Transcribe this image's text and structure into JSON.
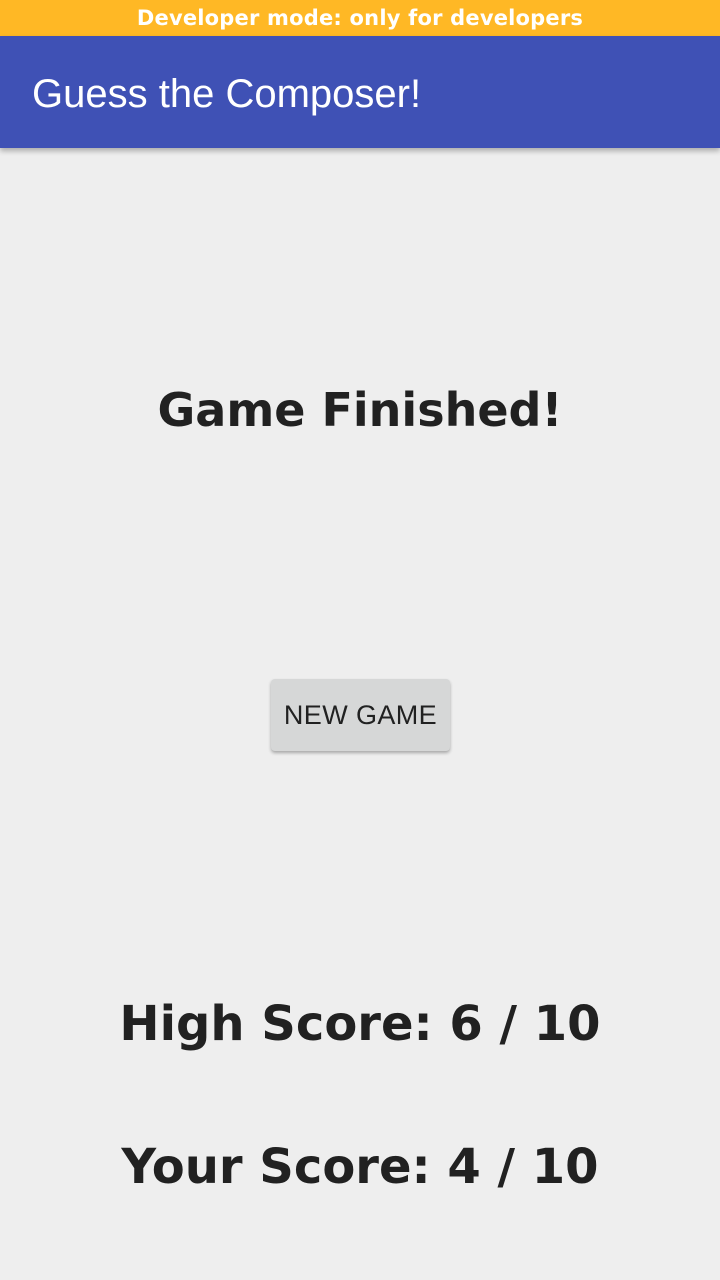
{
  "dev_banner": {
    "text": "Developer mode: only for developers",
    "color": "#ffb825"
  },
  "app_bar": {
    "title": "Guess the Composer!",
    "color": "#3f51b5"
  },
  "main": {
    "status": "Game Finished!",
    "new_game_label": "NEW GAME",
    "high_score": "High Score: 6 / 10",
    "your_score": "Your Score: 4 / 10"
  }
}
